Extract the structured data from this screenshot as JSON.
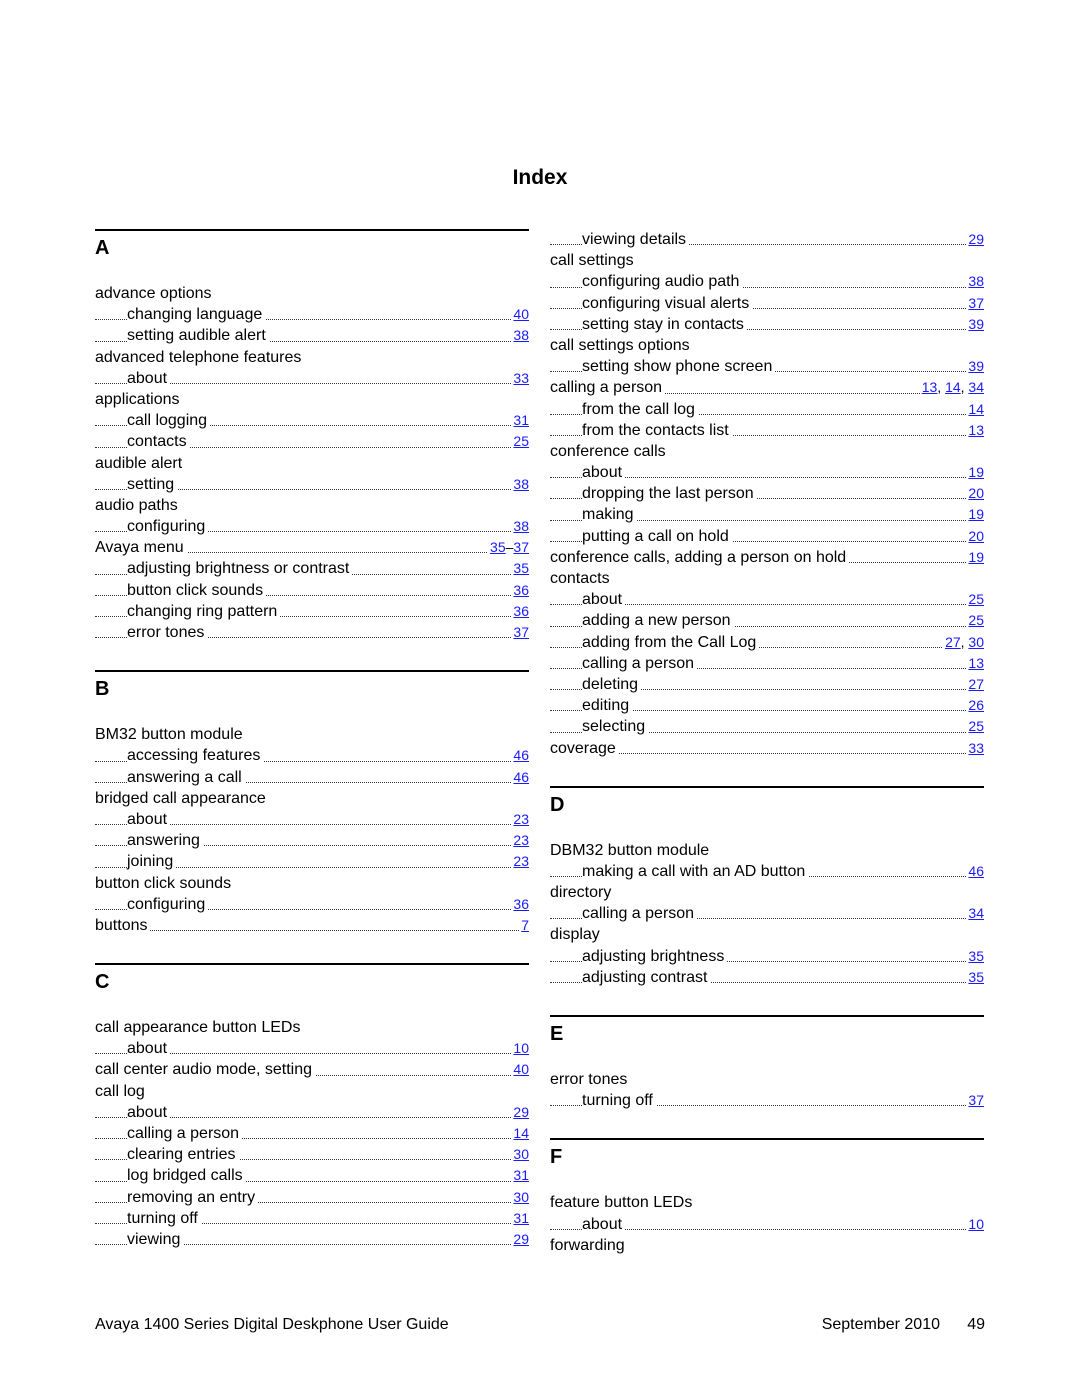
{
  "title": "Index",
  "columns": [
    [
      {
        "letter": "A",
        "entries": [
          {
            "text": "advance options",
            "level": 0,
            "pages": []
          },
          {
            "text": "changing language",
            "level": 1,
            "pages": [
              "40"
            ]
          },
          {
            "text": "setting audible alert",
            "level": 1,
            "pages": [
              "38"
            ]
          },
          {
            "text": "advanced telephone features",
            "level": 0,
            "pages": []
          },
          {
            "text": "about",
            "level": 1,
            "pages": [
              "33"
            ]
          },
          {
            "text": "applications",
            "level": 0,
            "pages": []
          },
          {
            "text": "call logging",
            "level": 1,
            "pages": [
              "31"
            ]
          },
          {
            "text": "contacts",
            "level": 1,
            "pages": [
              "25"
            ]
          },
          {
            "text": "audible alert",
            "level": 0,
            "pages": []
          },
          {
            "text": "setting",
            "level": 1,
            "pages": [
              "38"
            ]
          },
          {
            "text": "audio paths",
            "level": 0,
            "pages": []
          },
          {
            "text": "configuring",
            "level": 1,
            "pages": [
              "38"
            ]
          },
          {
            "text": "Avaya menu",
            "level": 0,
            "pages": [
              "35",
              "37"
            ],
            "range": true
          },
          {
            "text": "adjusting brightness or contrast",
            "level": 1,
            "pages": [
              "35"
            ]
          },
          {
            "text": "button click sounds",
            "level": 1,
            "pages": [
              "36"
            ]
          },
          {
            "text": "changing ring pattern",
            "level": 1,
            "pages": [
              "36"
            ]
          },
          {
            "text": "error tones",
            "level": 1,
            "pages": [
              "37"
            ]
          }
        ]
      },
      {
        "letter": "B",
        "entries": [
          {
            "text": "BM32 button module",
            "level": 0,
            "pages": []
          },
          {
            "text": "accessing features",
            "level": 1,
            "pages": [
              "46"
            ]
          },
          {
            "text": "answering a call",
            "level": 1,
            "pages": [
              "46"
            ]
          },
          {
            "text": "bridged call appearance",
            "level": 0,
            "pages": []
          },
          {
            "text": "about",
            "level": 1,
            "pages": [
              "23"
            ]
          },
          {
            "text": "answering",
            "level": 1,
            "pages": [
              "23"
            ]
          },
          {
            "text": "joining",
            "level": 1,
            "pages": [
              "23"
            ]
          },
          {
            "text": "button click sounds",
            "level": 0,
            "pages": []
          },
          {
            "text": "configuring",
            "level": 1,
            "pages": [
              "36"
            ]
          },
          {
            "text": "buttons",
            "level": 0,
            "pages": [
              "7"
            ]
          }
        ]
      },
      {
        "letter": "C",
        "entries": [
          {
            "text": "call appearance button LEDs",
            "level": 0,
            "pages": []
          },
          {
            "text": "about",
            "level": 1,
            "pages": [
              "10"
            ]
          },
          {
            "text": "call center audio mode, setting",
            "level": 0,
            "pages": [
              "40"
            ]
          },
          {
            "text": "call log",
            "level": 0,
            "pages": []
          },
          {
            "text": "about",
            "level": 1,
            "pages": [
              "29"
            ]
          },
          {
            "text": "calling a person",
            "level": 1,
            "pages": [
              "14"
            ]
          },
          {
            "text": "clearing entries",
            "level": 1,
            "pages": [
              "30"
            ]
          },
          {
            "text": "log bridged calls",
            "level": 1,
            "pages": [
              "31"
            ]
          },
          {
            "text": "removing an entry",
            "level": 1,
            "pages": [
              "30"
            ]
          },
          {
            "text": "turning off",
            "level": 1,
            "pages": [
              "31"
            ]
          },
          {
            "text": "viewing",
            "level": 1,
            "pages": [
              "29"
            ]
          }
        ]
      }
    ],
    [
      {
        "letter": null,
        "entries": [
          {
            "text": "viewing details",
            "level": 1,
            "pages": [
              "29"
            ]
          },
          {
            "text": "call settings",
            "level": 0,
            "pages": []
          },
          {
            "text": "configuring audio path",
            "level": 1,
            "pages": [
              "38"
            ]
          },
          {
            "text": "configuring visual alerts",
            "level": 1,
            "pages": [
              "37"
            ]
          },
          {
            "text": "setting stay in contacts",
            "level": 1,
            "pages": [
              "39"
            ]
          },
          {
            "text": "call settings options",
            "level": 0,
            "pages": []
          },
          {
            "text": "setting show phone screen",
            "level": 1,
            "pages": [
              "39"
            ]
          },
          {
            "text": "calling a person",
            "level": 0,
            "pages": [
              "13",
              "14",
              "34"
            ]
          },
          {
            "text": "from the call log",
            "level": 1,
            "pages": [
              "14"
            ]
          },
          {
            "text": "from the contacts list",
            "level": 1,
            "pages": [
              "13"
            ]
          },
          {
            "text": "conference calls",
            "level": 0,
            "pages": []
          },
          {
            "text": "about",
            "level": 1,
            "pages": [
              "19"
            ]
          },
          {
            "text": "dropping the last person",
            "level": 1,
            "pages": [
              "20"
            ]
          },
          {
            "text": "making",
            "level": 1,
            "pages": [
              "19"
            ]
          },
          {
            "text": "putting a call on hold",
            "level": 1,
            "pages": [
              "20"
            ]
          },
          {
            "text": "conference calls, adding a person on hold",
            "level": 0,
            "pages": [
              "19"
            ]
          },
          {
            "text": "contacts",
            "level": 0,
            "pages": []
          },
          {
            "text": "about",
            "level": 1,
            "pages": [
              "25"
            ]
          },
          {
            "text": "adding a new person",
            "level": 1,
            "pages": [
              "25"
            ]
          },
          {
            "text": "adding from the Call Log",
            "level": 1,
            "pages": [
              "27",
              "30"
            ]
          },
          {
            "text": "calling a person",
            "level": 1,
            "pages": [
              "13"
            ]
          },
          {
            "text": "deleting",
            "level": 1,
            "pages": [
              "27"
            ]
          },
          {
            "text": "editing",
            "level": 1,
            "pages": [
              "26"
            ]
          },
          {
            "text": "selecting",
            "level": 1,
            "pages": [
              "25"
            ]
          },
          {
            "text": "coverage",
            "level": 0,
            "pages": [
              "33"
            ]
          }
        ]
      },
      {
        "letter": "D",
        "entries": [
          {
            "text": "DBM32 button module",
            "level": 0,
            "pages": []
          },
          {
            "text": "making a call with an AD button",
            "level": 1,
            "pages": [
              "46"
            ]
          },
          {
            "text": "directory",
            "level": 0,
            "pages": []
          },
          {
            "text": "calling a person",
            "level": 1,
            "pages": [
              "34"
            ]
          },
          {
            "text": "display",
            "level": 0,
            "pages": []
          },
          {
            "text": "adjusting brightness",
            "level": 1,
            "pages": [
              "35"
            ]
          },
          {
            "text": "adjusting contrast",
            "level": 1,
            "pages": [
              "35"
            ]
          }
        ]
      },
      {
        "letter": "E",
        "entries": [
          {
            "text": "error tones",
            "level": 0,
            "pages": []
          },
          {
            "text": "turning off",
            "level": 1,
            "pages": [
              "37"
            ]
          }
        ]
      },
      {
        "letter": "F",
        "entries": [
          {
            "text": "feature button LEDs",
            "level": 0,
            "pages": []
          },
          {
            "text": "about",
            "level": 1,
            "pages": [
              "10"
            ]
          },
          {
            "text": "forwarding",
            "level": 0,
            "pages": []
          }
        ]
      }
    ]
  ],
  "footer": {
    "guide_title": "Avaya 1400 Series Digital Deskphone User Guide",
    "date": "September 2010",
    "page_number": "49"
  },
  "colors": {
    "link": "#1a1aff",
    "text": "#000000"
  }
}
